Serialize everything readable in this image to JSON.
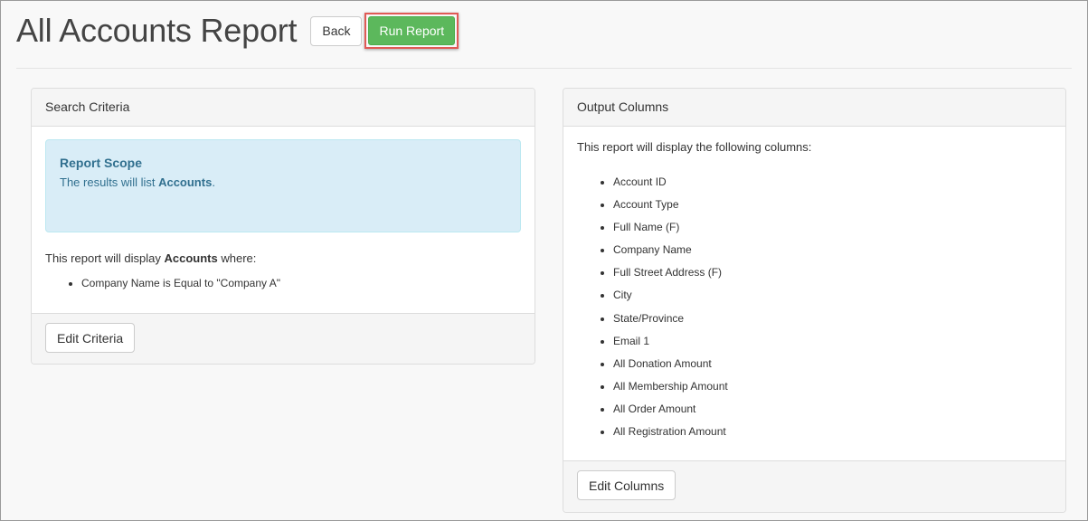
{
  "header": {
    "title": "All Accounts Report",
    "back_label": "Back",
    "run_label": "Run Report"
  },
  "search_criteria": {
    "heading": "Search Criteria",
    "scope": {
      "title": "Report Scope",
      "text_prefix": "The results will list ",
      "entity": "Accounts",
      "text_suffix": "."
    },
    "display": {
      "prefix": "This report will display ",
      "entity": "Accounts",
      "suffix": " where:"
    },
    "criteria": [
      "Company Name is Equal to \"Company A\""
    ],
    "edit_label": "Edit Criteria"
  },
  "output_columns": {
    "heading": "Output Columns",
    "intro": "This report will display the following columns:",
    "columns": [
      "Account ID",
      "Account Type",
      "Full Name (F)",
      "Company Name",
      "Full Street Address (F)",
      "City",
      "State/Province",
      "Email 1",
      "All Donation Amount",
      "All Membership Amount",
      "All Order Amount",
      "All Registration Amount"
    ],
    "edit_label": "Edit Columns"
  },
  "colors": {
    "run_button": "#5cb85c",
    "highlight_border": "#e05a55",
    "alert_bg": "#d9edf7",
    "alert_text": "#31708f"
  }
}
